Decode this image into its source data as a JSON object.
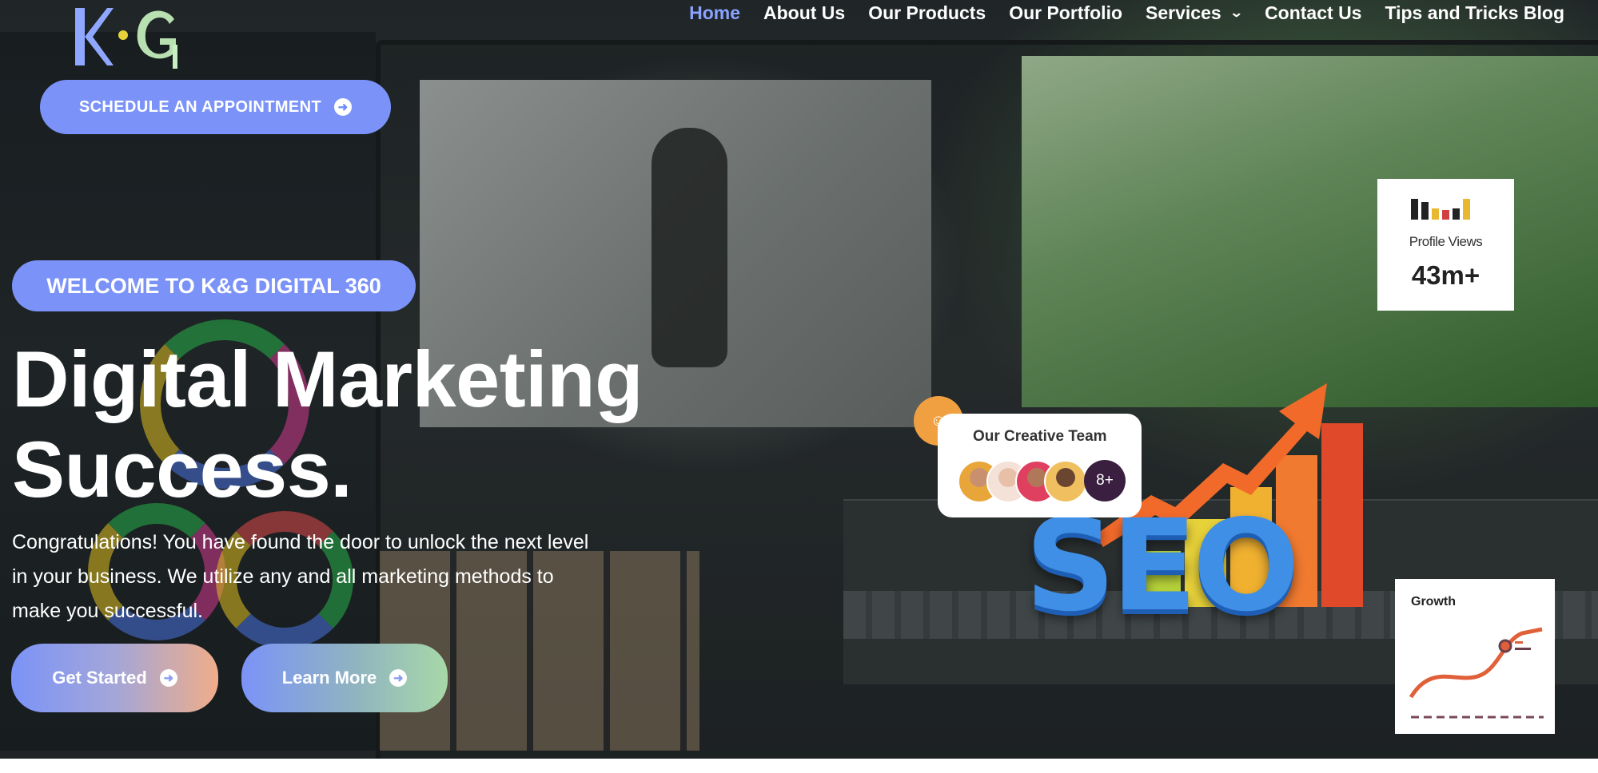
{
  "brand": {
    "logo_text": "K&G"
  },
  "nav": {
    "items": [
      {
        "label": "Home",
        "active": true
      },
      {
        "label": "About Us",
        "active": false
      },
      {
        "label": "Our Products",
        "active": false
      },
      {
        "label": "Our Portfolio",
        "active": false
      },
      {
        "label": "Services",
        "active": false,
        "has_dropdown": true
      },
      {
        "label": "Contact Us",
        "active": false
      },
      {
        "label": "Tips and Tricks Blog",
        "active": false
      }
    ]
  },
  "header": {
    "appointment_button": "SCHEDULE AN APPOINTMENT"
  },
  "hero": {
    "welcome_badge": "WELCOME TO K&G DIGITAL 360",
    "headline_line1": "Digital Marketing",
    "headline_line2": "Success.",
    "intro_line1": "Congratulations! You have found the door to unlock the next level",
    "intro_line2": "in your business. We utilize any and all marketing methods to",
    "intro_line3": "make you successful.",
    "get_started_button": "Get Started",
    "learn_more_button": "Learn More"
  },
  "stats_card": {
    "label": "Profile Views",
    "value": "43m+"
  },
  "team_card": {
    "title": "Our Creative Team",
    "more_count": "8+"
  },
  "growth_card": {
    "title": "Growth"
  },
  "seo_graphic": {
    "text": "SEO"
  },
  "colors": {
    "accent": "#7b93f8",
    "nav_active": "#8aa3ff",
    "team_badge": "#f0a040",
    "seo_blue": "#3f8fe6",
    "growth_line": "#e0603a"
  },
  "icons": [
    "arrow-right-circle-icon",
    "chevron-down-icon",
    "people-icon",
    "bar-chart-icon",
    "growth-line-icon"
  ]
}
